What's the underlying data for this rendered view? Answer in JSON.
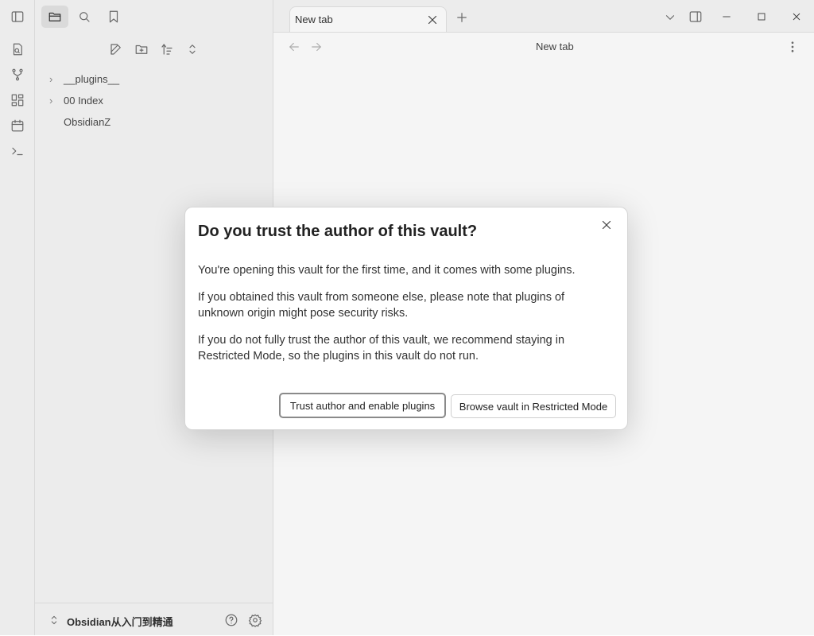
{
  "sidebar": {
    "tree": [
      {
        "label": "__plugins__",
        "collapsible": true
      },
      {
        "label": "00 Index",
        "collapsible": true
      },
      {
        "label": "ObsidianZ",
        "collapsible": false
      }
    ],
    "vault_name": "Obsidian从入门到精通"
  },
  "tabs": [
    {
      "title": "New tab"
    }
  ],
  "main": {
    "nav_title": "New tab"
  },
  "modal": {
    "title": "Do you trust the author of this vault?",
    "paragraphs": [
      "You're opening this vault for the first time, and it comes with some plugins.",
      "If you obtained this vault from someone else, please note that plugins of unknown origin might pose security risks.",
      "If you do not fully trust the author of this vault, we recommend staying in Restricted Mode, so the plugins in this vault do not run."
    ],
    "primary_button": "Trust author and enable plugins",
    "secondary_button": "Browse vault in Restricted Mode"
  }
}
